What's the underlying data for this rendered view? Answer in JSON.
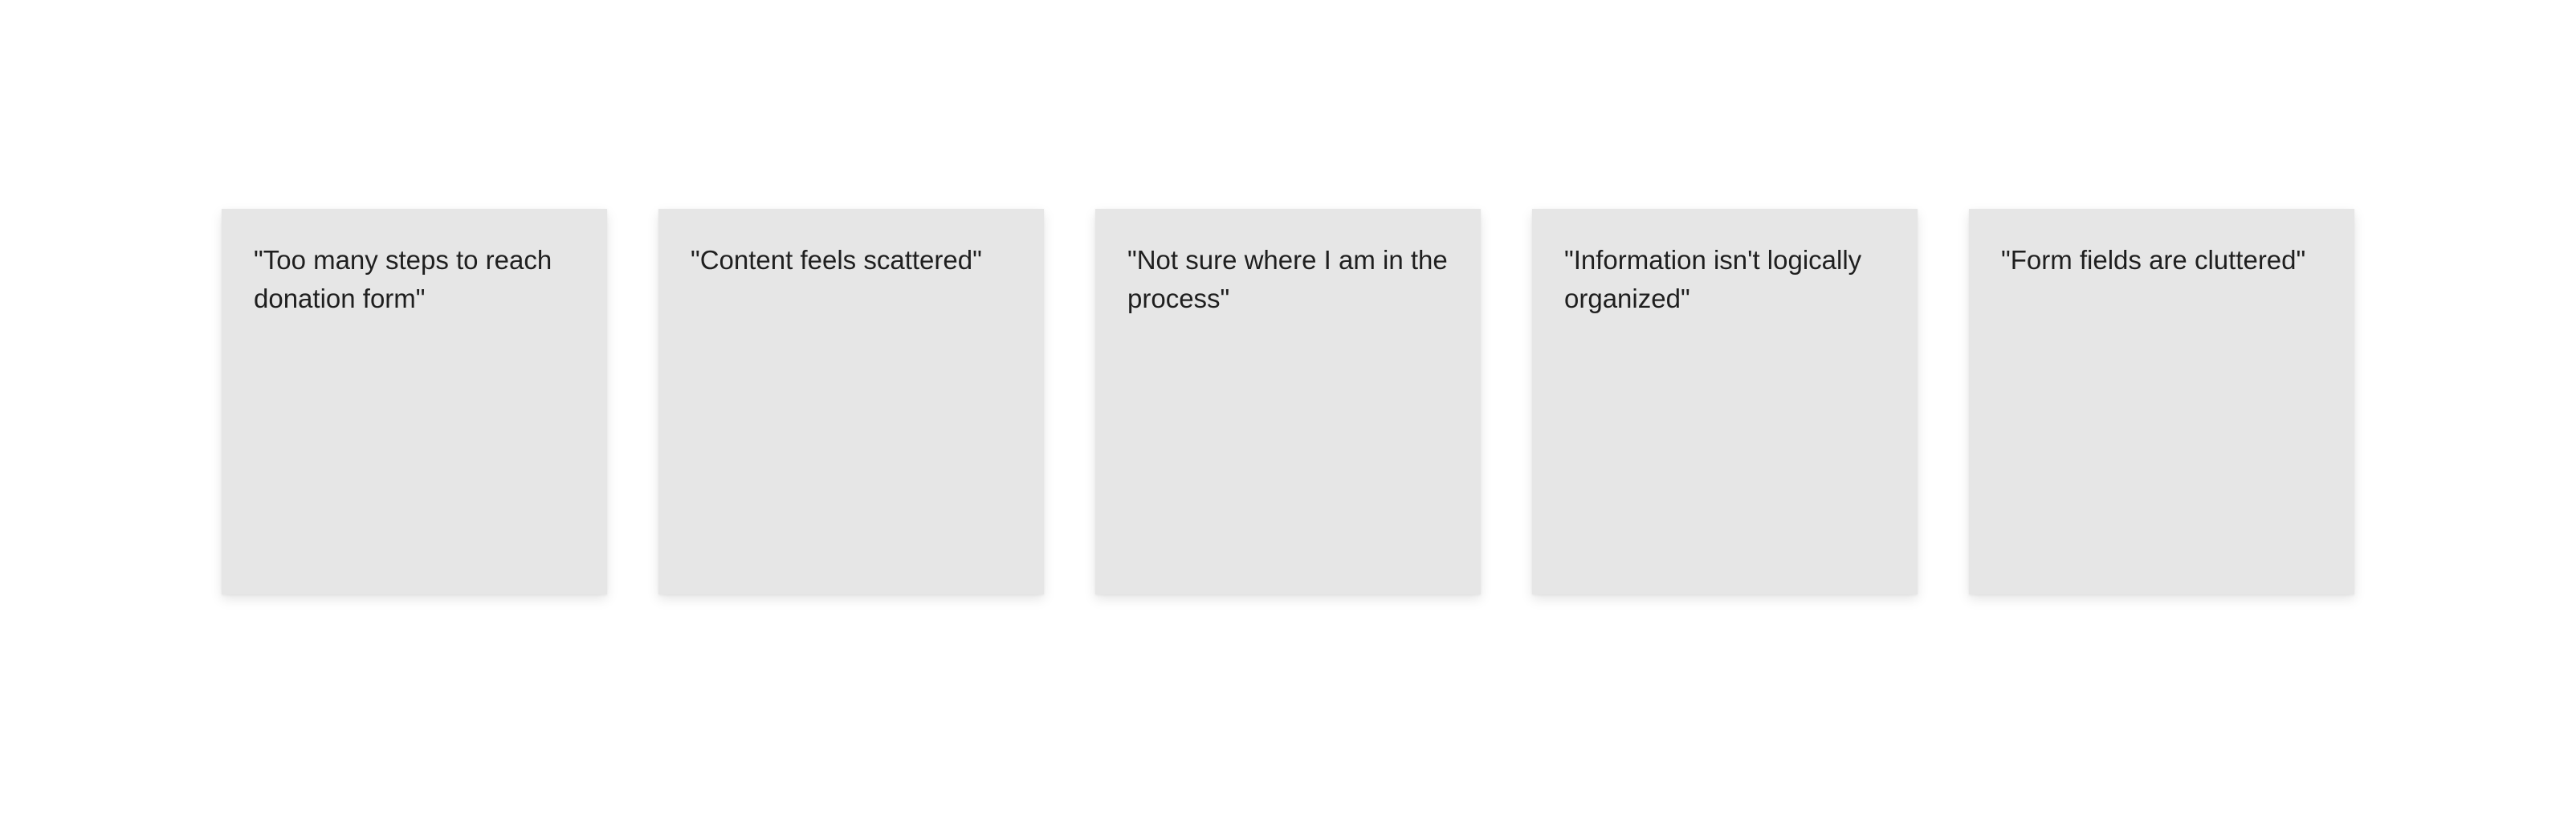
{
  "notes": [
    {
      "text": "\"Too many steps to reach donation form\""
    },
    {
      "text": "\"Content feels scattered\""
    },
    {
      "text": "\"Not sure where I am in the process\""
    },
    {
      "text": "\"Information isn't logically organized\""
    },
    {
      "text": "\"Form fields are cluttered\""
    }
  ],
  "colors": {
    "background": "#ffffff",
    "note_fill": "#e6e6e6",
    "note_text": "#1f1f1f"
  }
}
